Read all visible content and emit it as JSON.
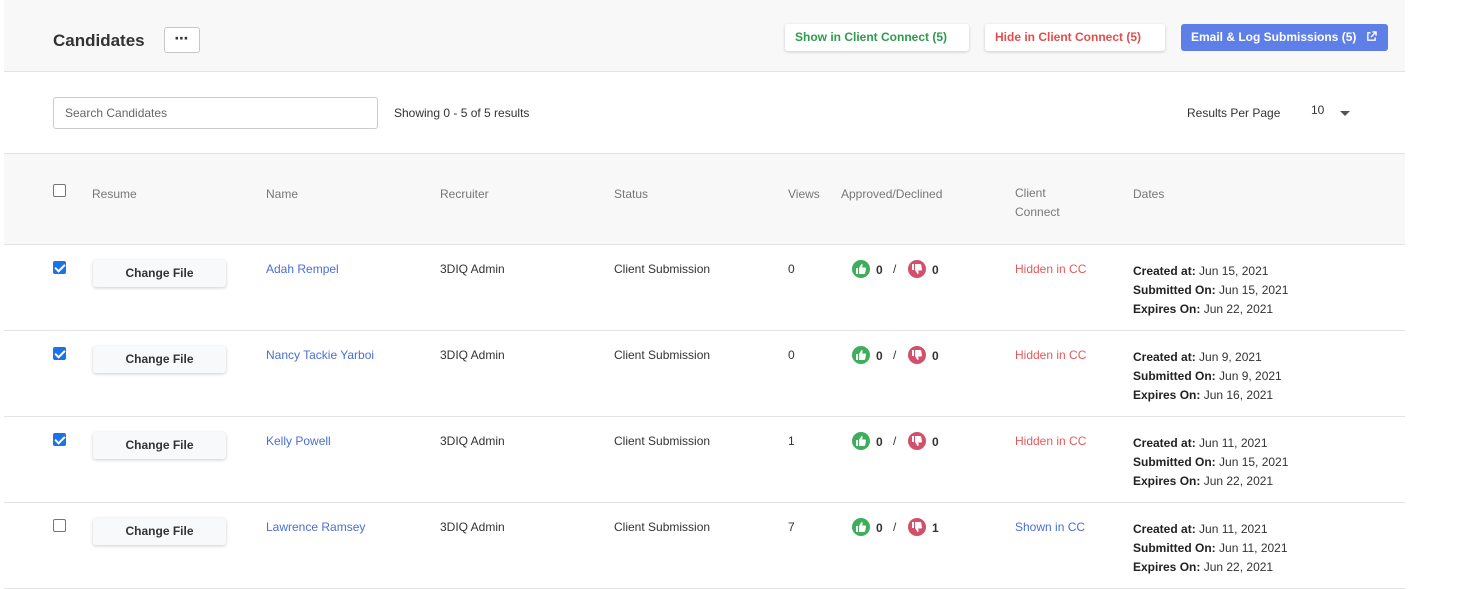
{
  "header": {
    "title": "Candidates",
    "more_label": "⋯",
    "show_btn": "Show in Client Connect (5)",
    "hide_btn": "Hide in Client Connect (5)",
    "email_btn": "Email & Log Submissions (5)"
  },
  "toolbar": {
    "search_placeholder": "Search Candidates",
    "showing": "Showing 0 - 5 of 5 results",
    "rpp_label": "Results Per Page",
    "rpp_value": "10"
  },
  "columns": {
    "resume": "Resume",
    "name": "Name",
    "recruiter": "Recruiter",
    "status": "Status",
    "views": "Views",
    "approved": "Approved/Declined",
    "cc_line1": "Client",
    "cc_line2": "Connect",
    "dates": "Dates"
  },
  "labels": {
    "change_file": "Change File",
    "slash": "/",
    "created": "Created at:",
    "submitted": "Submitted On:",
    "expires": "Expires On:"
  },
  "rows": [
    {
      "checked": true,
      "name": "Adah Rempel",
      "recruiter": "3DIQ Admin",
      "status": "Client Submission",
      "views": "0",
      "approved": "0",
      "declined": "0",
      "cc": "Hidden in CC",
      "cc_state": "hidden",
      "created": "Jun 15, 2021",
      "submitted": "Jun 15, 2021",
      "expires": "Jun 22, 2021"
    },
    {
      "checked": true,
      "name": "Nancy Tackie Yarboi",
      "recruiter": "3DIQ Admin",
      "status": "Client Submission",
      "views": "0",
      "approved": "0",
      "declined": "0",
      "cc": "Hidden in CC",
      "cc_state": "hidden",
      "created": "Jun 9, 2021",
      "submitted": "Jun 9, 2021",
      "expires": "Jun 16, 2021"
    },
    {
      "checked": true,
      "name": "Kelly Powell",
      "recruiter": "3DIQ Admin",
      "status": "Client Submission",
      "views": "1",
      "approved": "0",
      "declined": "0",
      "cc": "Hidden in CC",
      "cc_state": "hidden",
      "created": "Jun 11, 2021",
      "submitted": "Jun 15, 2021",
      "expires": "Jun 22, 2021"
    },
    {
      "checked": false,
      "name": "Lawrence Ramsey",
      "recruiter": "3DIQ Admin",
      "status": "Client Submission",
      "views": "7",
      "approved": "0",
      "declined": "1",
      "cc": "Shown in CC",
      "cc_state": "shown",
      "created": "Jun 11, 2021",
      "submitted": "Jun 11, 2021",
      "expires": "Jun 22, 2021"
    }
  ]
}
